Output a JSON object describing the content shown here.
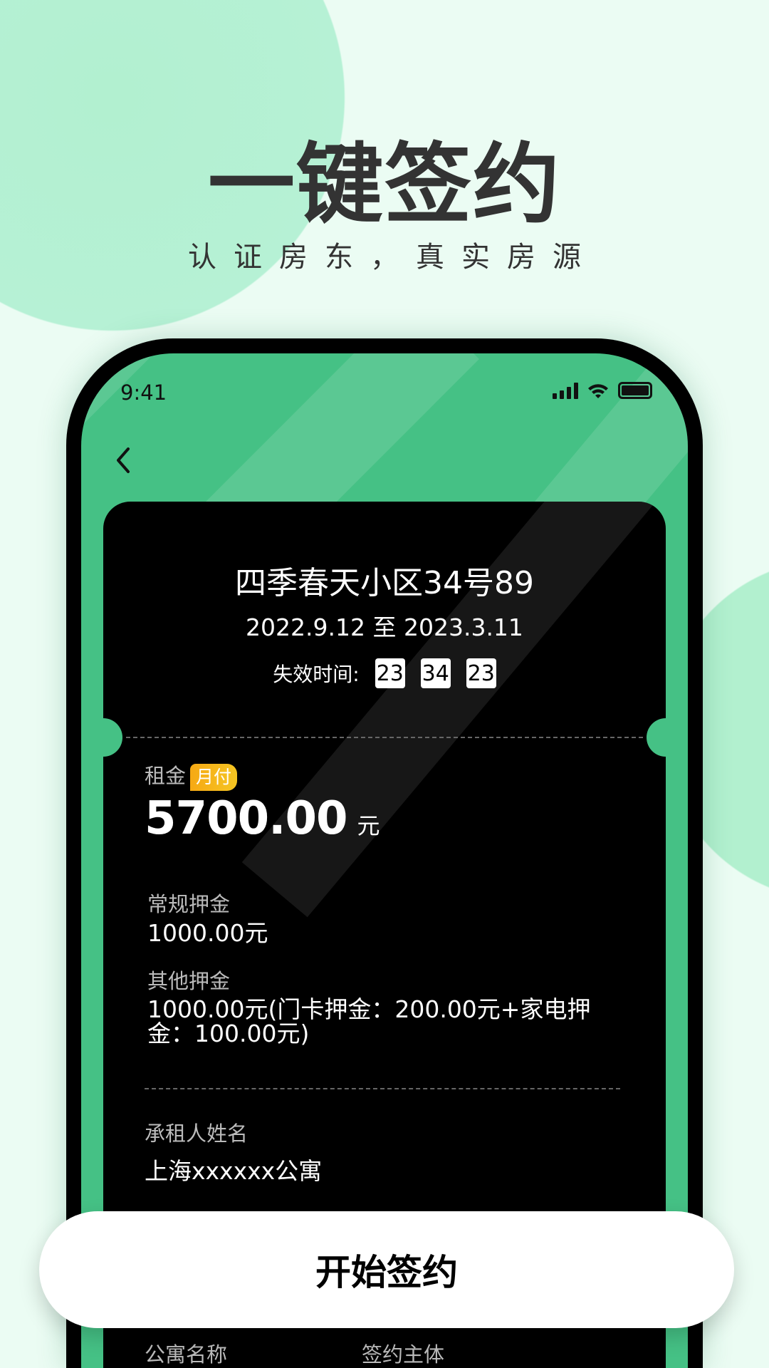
{
  "hero": {
    "title": "一键签约",
    "subtitle": "认证房东，真实房源"
  },
  "status_bar": {
    "time": "9:41",
    "icons": [
      "signal-icon",
      "wifi-icon",
      "battery-icon"
    ]
  },
  "nav": {
    "back_icon": "chevron-left-icon"
  },
  "contract": {
    "property": "四季春天小区34号89",
    "period": "2022.9.12 至 2023.3.11",
    "expiry_label": "失效时间:",
    "expiry": [
      "23",
      "34",
      "23"
    ],
    "rent_label": "租金",
    "rent_badge": "月付",
    "rent_amount": "5700.00",
    "rent_unit": "元",
    "deposit_label": "常规押金",
    "deposit_value": "1000.00元",
    "other_deposit_label": "其他押金",
    "other_deposit_value": "1000.00元(门卡押金：200.00元+家电押金：100.00元)",
    "tenant_label": "承租人姓名",
    "tenant_value": "上海xxxxxx公寓",
    "apartment_label": "公寓名称",
    "signer_label": "签约主体"
  },
  "actions": {
    "start_sign": "开始签约"
  },
  "colors": {
    "background": "#ebfcf3",
    "accent": "#45c185",
    "badge": "#f5b81a",
    "card": "#000000"
  }
}
